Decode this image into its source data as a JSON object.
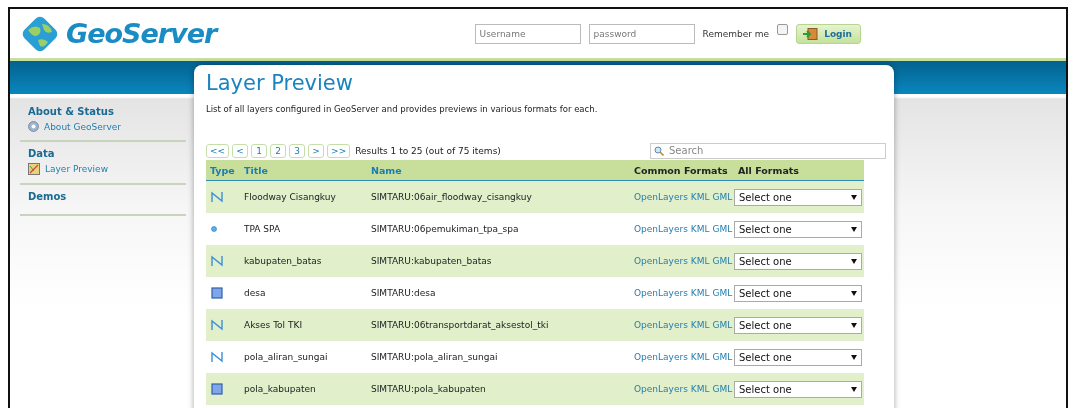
{
  "logo": {
    "text": "GeoServer"
  },
  "login": {
    "username_placeholder": "Username",
    "password_placeholder": "password",
    "remember_label": "Remember me",
    "remember_checked": false,
    "button": "Login"
  },
  "sidebar": {
    "sections": [
      {
        "title": "About & Status",
        "items": [
          {
            "label": "About GeoServer",
            "kind": "about"
          }
        ]
      },
      {
        "title": "Data",
        "items": [
          {
            "label": "Layer Preview",
            "kind": "preview"
          }
        ]
      },
      {
        "title": "Demos"
      }
    ]
  },
  "page": {
    "title": "Layer Preview",
    "description": "List of all layers configured in GeoServer and provides previews in various formats for each."
  },
  "pager": {
    "buttons": [
      "<<",
      "<",
      "1",
      "2",
      "3",
      ">",
      ">>"
    ],
    "summary": "Results 1 to 25 (out of 75 items)"
  },
  "search": {
    "placeholder": "Search"
  },
  "table": {
    "columns": [
      {
        "label": "Type",
        "sortable": true
      },
      {
        "label": "Title",
        "sortable": true
      },
      {
        "label": "Name",
        "sortable": true
      },
      {
        "label": "Common Formats",
        "sortable": false
      },
      {
        "label": "All Formats",
        "sortable": false
      }
    ],
    "rows": [
      {
        "kind": "line",
        "title": "Floodway Cisangkuy",
        "name": "SIMTARU:06air_floodway_cisangkuy",
        "formats": [
          "OpenLayers",
          "KML",
          "GML"
        ],
        "select": "Select one"
      },
      {
        "kind": "point",
        "title": "TPA SPA",
        "name": "SIMTARU:06pemukiman_tpa_spa",
        "formats": [
          "OpenLayers",
          "KML",
          "GML"
        ],
        "select": "Select one"
      },
      {
        "kind": "line",
        "title": "kabupaten_batas",
        "name": "SIMTARU:kabupaten_batas",
        "formats": [
          "OpenLayers",
          "KML",
          "GML"
        ],
        "select": "Select one"
      },
      {
        "kind": "polygon",
        "title": "desa",
        "name": "SIMTARU:desa",
        "formats": [
          "OpenLayers",
          "KML",
          "GML"
        ],
        "select": "Select one"
      },
      {
        "kind": "line",
        "title": "Akses Tol TKI",
        "name": "SIMTARU:06transportdarat_aksestol_tki",
        "formats": [
          "OpenLayers",
          "KML",
          "GML"
        ],
        "select": "Select one"
      },
      {
        "kind": "line",
        "title": "pola_aliran_sungai",
        "name": "SIMTARU:pola_aliran_sungai",
        "formats": [
          "OpenLayers",
          "KML",
          "GML"
        ],
        "select": "Select one"
      },
      {
        "kind": "polygon",
        "title": "pola_kabupaten",
        "name": "SIMTARU:pola_kabupaten",
        "formats": [
          "OpenLayers",
          "KML",
          "GML"
        ],
        "select": "Select one"
      }
    ]
  }
}
